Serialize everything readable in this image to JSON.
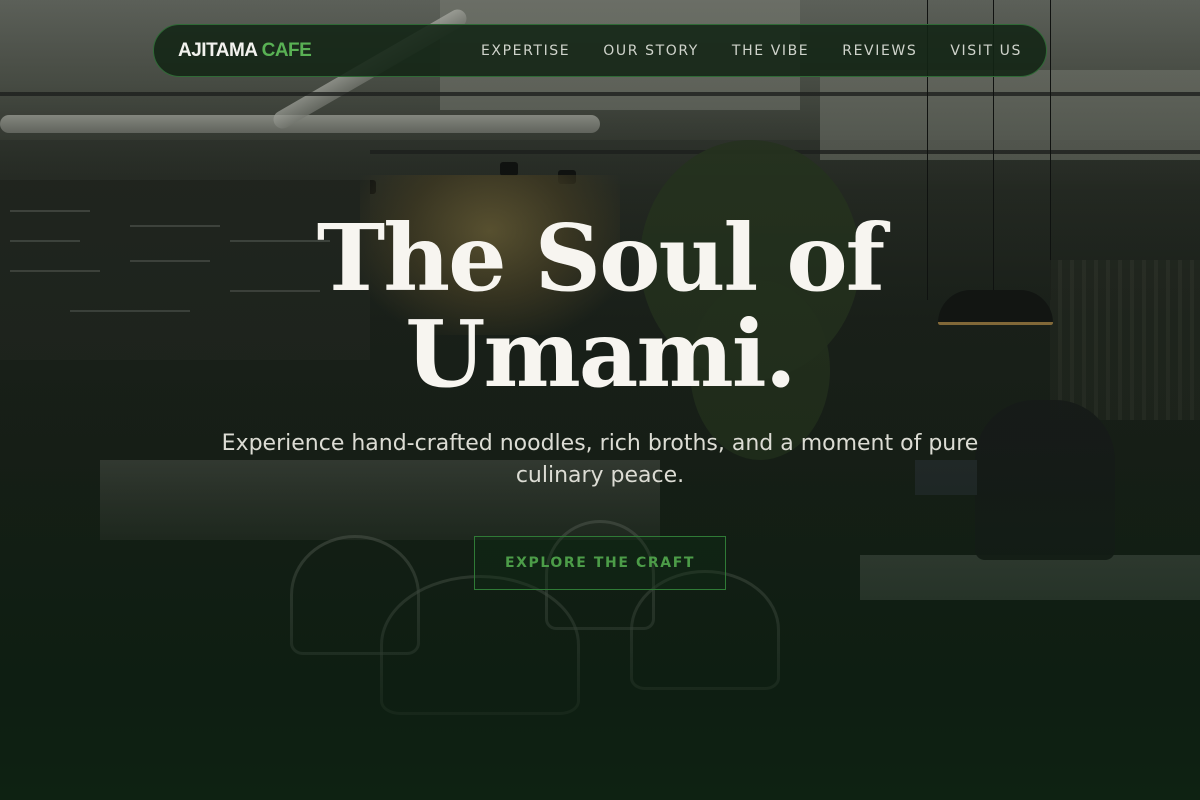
{
  "nav": {
    "logo_primary": "AJITAMA",
    "logo_accent": "CAFE",
    "links": [
      "EXPERTISE",
      "OUR STORY",
      "THE VIBE",
      "REVIEWS",
      "VISIT US"
    ]
  },
  "hero": {
    "headline_line1": "The Soul of",
    "headline_line2": "Umami.",
    "subtitle": "Experience hand-crafted noodles, rich broths, and a moment of pure culinary peace.",
    "cta_label": "EXPLORE THE CRAFT"
  },
  "colors": {
    "accent": "#59b154",
    "nav_background": "#122414",
    "headline": "#f7f5f0"
  }
}
